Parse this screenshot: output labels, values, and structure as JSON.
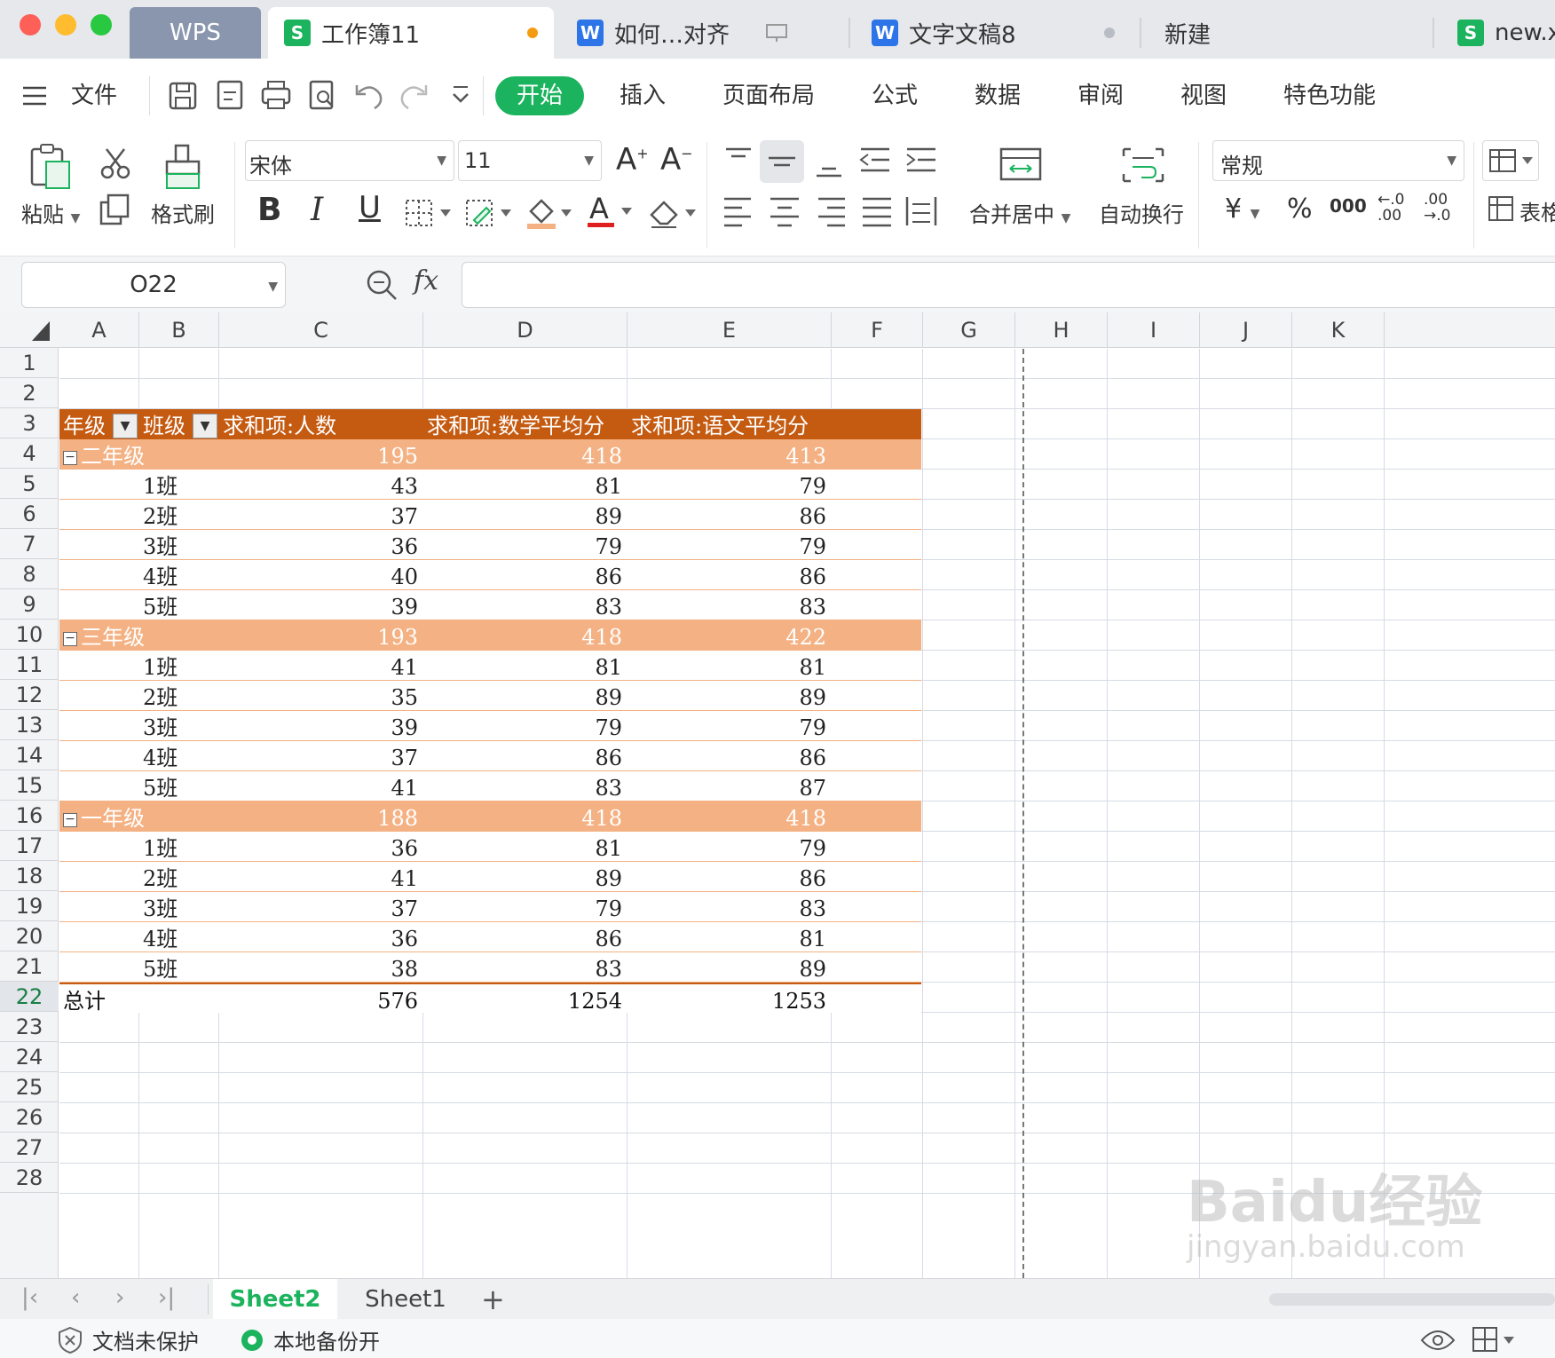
{
  "tabs": {
    "wps_label": "WPS",
    "active_label": "工作簿11",
    "tab2_label": "如何…对齐",
    "tab3_label": "文字文稿8",
    "new_label": "新建",
    "tab5_label": "new.x"
  },
  "menu": {
    "file": "文件",
    "items": [
      "开始",
      "插入",
      "页面布局",
      "公式",
      "数据",
      "审阅",
      "视图",
      "特色功能"
    ]
  },
  "ribbon": {
    "paste": "粘贴",
    "format_painter": "格式刷",
    "font_name": "宋体",
    "font_size": "11",
    "merge_center": "合并居中",
    "wrap_text": "自动换行",
    "number_format": "常规",
    "table_style": "表格"
  },
  "formula_bar": {
    "name_box": "O22",
    "fx": "fx",
    "formula": ""
  },
  "columns": [
    "A",
    "B",
    "C",
    "D",
    "E",
    "F",
    "G",
    "H",
    "I",
    "J",
    "K"
  ],
  "rows": [
    "1",
    "2",
    "3",
    "4",
    "5",
    "6",
    "7",
    "8",
    "9",
    "10",
    "11",
    "12",
    "13",
    "14",
    "15",
    "16",
    "17",
    "18",
    "19",
    "20",
    "21",
    "22",
    "23",
    "24",
    "25",
    "26",
    "27",
    "28"
  ],
  "pivot": {
    "headers": [
      "年级",
      "班级",
      "求和项:人数",
      "求和项:数学平均分",
      "求和项:语文平均分"
    ],
    "groups": [
      {
        "name": "二年级",
        "totals": [
          "195",
          "418",
          "413"
        ],
        "classes": [
          {
            "name": "1班",
            "values": [
              "43",
              "81",
              "79"
            ]
          },
          {
            "name": "2班",
            "values": [
              "37",
              "89",
              "86"
            ]
          },
          {
            "name": "3班",
            "values": [
              "36",
              "79",
              "79"
            ]
          },
          {
            "name": "4班",
            "values": [
              "40",
              "86",
              "86"
            ]
          },
          {
            "name": "5班",
            "values": [
              "39",
              "83",
              "83"
            ]
          }
        ]
      },
      {
        "name": "三年级",
        "totals": [
          "193",
          "418",
          "422"
        ],
        "classes": [
          {
            "name": "1班",
            "values": [
              "41",
              "81",
              "81"
            ]
          },
          {
            "name": "2班",
            "values": [
              "35",
              "89",
              "89"
            ]
          },
          {
            "name": "3班",
            "values": [
              "39",
              "79",
              "79"
            ]
          },
          {
            "name": "4班",
            "values": [
              "37",
              "86",
              "86"
            ]
          },
          {
            "name": "5班",
            "values": [
              "41",
              "83",
              "87"
            ]
          }
        ]
      },
      {
        "name": "一年级",
        "totals": [
          "188",
          "418",
          "418"
        ],
        "classes": [
          {
            "name": "1班",
            "values": [
              "36",
              "81",
              "79"
            ]
          },
          {
            "name": "2班",
            "values": [
              "41",
              "89",
              "86"
            ]
          },
          {
            "name": "3班",
            "values": [
              "37",
              "79",
              "83"
            ]
          },
          {
            "name": "4班",
            "values": [
              "36",
              "86",
              "81"
            ]
          },
          {
            "name": "5班",
            "values": [
              "38",
              "83",
              "89"
            ]
          }
        ]
      }
    ],
    "total_label": "总计",
    "grand_totals": [
      "576",
      "1254",
      "1253"
    ]
  },
  "sheets": [
    "Sheet2",
    "Sheet1"
  ],
  "status": {
    "protect": "文档未保护",
    "backup": "本地备份开"
  },
  "watermark": "Baidu经验 jingyan.baidu.com",
  "colors": {
    "accent": "#1bb35d",
    "pivot_header": "#c55a11",
    "pivot_group": "#f4b183"
  }
}
